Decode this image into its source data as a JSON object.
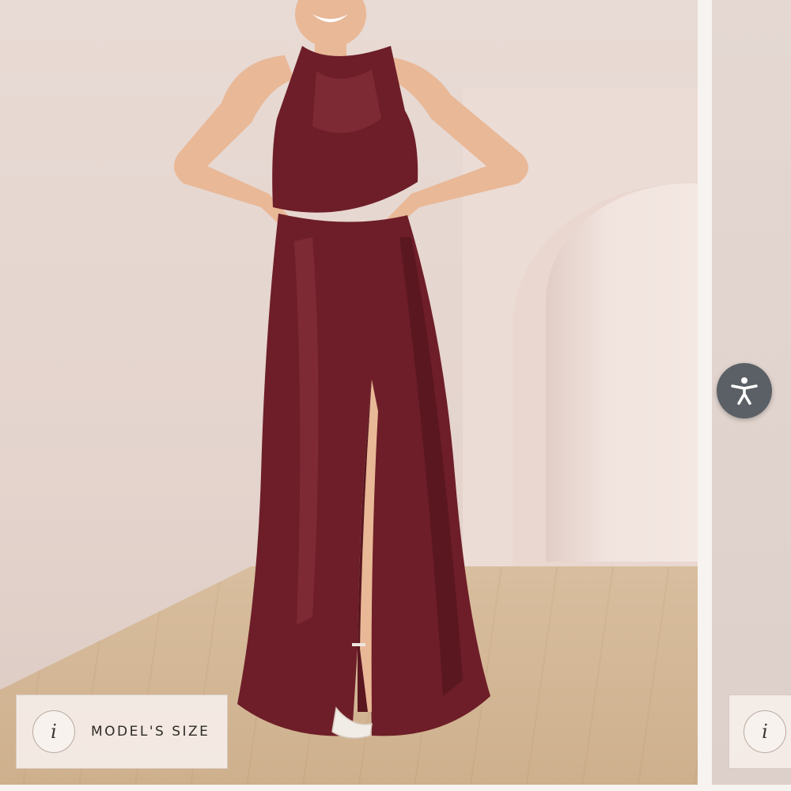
{
  "gallery": {
    "main_slide": {
      "model_size_label": "MODEL'S SIZE",
      "info_icon_glyph": "i",
      "dress_color": "#6e1e28"
    },
    "next_slide": {
      "info_icon_glyph": "i"
    }
  },
  "accessibility": {
    "icon": "accessibility-person-icon",
    "color": "#5b6066"
  }
}
